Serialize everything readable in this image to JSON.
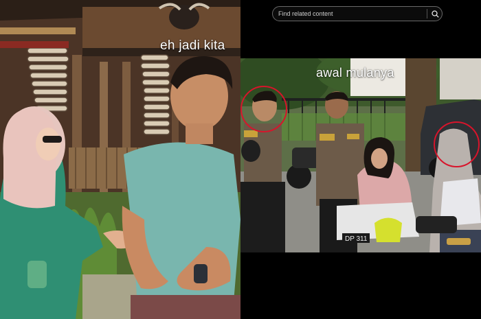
{
  "left_frame": {
    "caption": "eh jadi kita"
  },
  "right_panel": {
    "search": {
      "placeholder": "Find related content",
      "value": ""
    },
    "frame": {
      "caption": "awal mulanya",
      "plate_text": "DP 311"
    }
  },
  "colors": {
    "highlight": "#d8142b",
    "background": "#000000"
  },
  "icons": [
    "search-icon"
  ]
}
